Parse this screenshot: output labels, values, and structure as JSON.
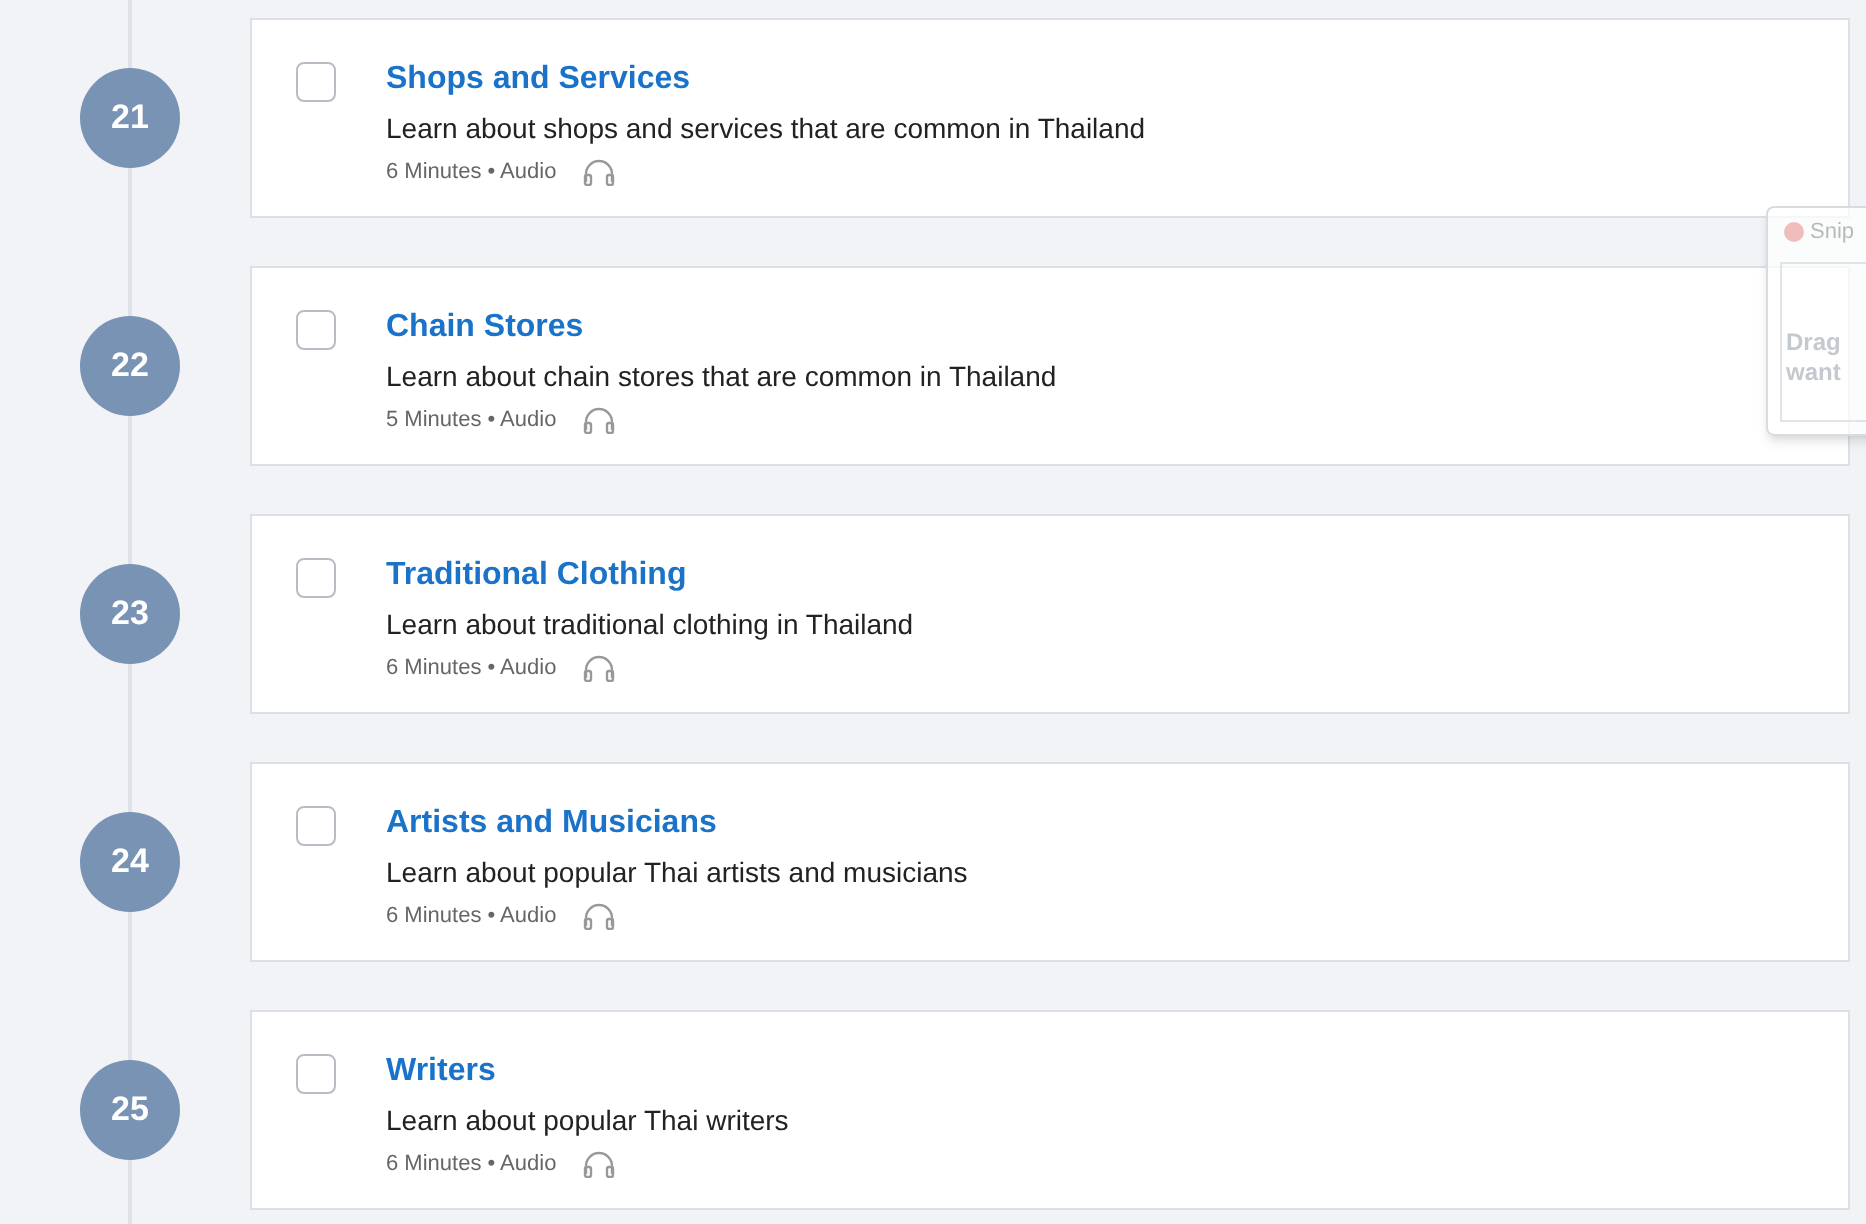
{
  "lessons": [
    {
      "number": "21",
      "title": "Shops and Services",
      "description": "Learn about shops and services that are common in Thailand",
      "duration": "6 Minutes",
      "separator": "•",
      "format": "Audio",
      "checked": false
    },
    {
      "number": "22",
      "title": "Chain Stores",
      "description": "Learn about chain stores that are common in Thailand",
      "duration": "5 Minutes",
      "separator": "•",
      "format": "Audio",
      "checked": false
    },
    {
      "number": "23",
      "title": "Traditional Clothing",
      "description": "Learn about traditional clothing in Thailand",
      "duration": "6 Minutes",
      "separator": "•",
      "format": "Audio",
      "checked": false
    },
    {
      "number": "24",
      "title": "Artists and Musicians",
      "description": "Learn about popular Thai artists and musicians",
      "duration": "6 Minutes",
      "separator": "•",
      "format": "Audio",
      "checked": false
    },
    {
      "number": "25",
      "title": "Writers",
      "description": "Learn about popular Thai writers",
      "duration": "6 Minutes",
      "separator": "•",
      "format": "Audio",
      "checked": false
    }
  ],
  "overlay_window": {
    "title": "Snip",
    "hint_lines": [
      "Drag",
      "want"
    ]
  }
}
